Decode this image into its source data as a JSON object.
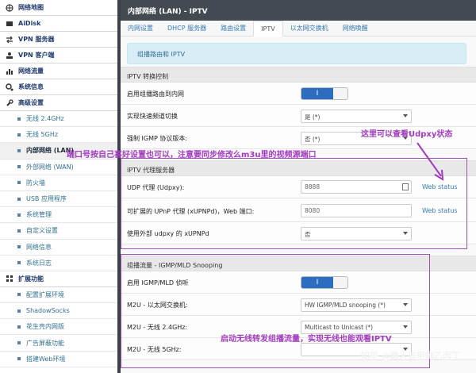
{
  "sidebar": {
    "top_items": [
      {
        "label": "网络地图",
        "icon": "globe-icon"
      },
      {
        "label": "AiDisk",
        "icon": "disk-icon"
      },
      {
        "label": "VPN 服务器",
        "icon": "swap-icon"
      },
      {
        "label": "VPN 客户端",
        "icon": "vpn-client-icon"
      },
      {
        "label": "网络流量",
        "icon": "chart-icon"
      },
      {
        "label": "系统信息",
        "icon": "gears-icon"
      },
      {
        "label": "高级设置",
        "icon": "wrench-icon"
      }
    ],
    "advanced_sub": [
      {
        "label": "无线 2.4GHz"
      },
      {
        "label": "无线 5GHz"
      },
      {
        "label": "内部网络 (LAN)",
        "current": true
      },
      {
        "label": "外部网络 (WAN)"
      },
      {
        "label": "防火墙"
      },
      {
        "label": "USB 应用程序"
      },
      {
        "label": "系统管理"
      },
      {
        "label": "自定义设置"
      },
      {
        "label": "网络信息"
      },
      {
        "label": "系统日志"
      }
    ],
    "ext_group": {
      "label": "扩展功能",
      "icon": "grid-icon"
    },
    "ext_sub": [
      {
        "label": "配置扩展环境"
      },
      {
        "label": "ShadowSocks"
      },
      {
        "label": "花生壳内网版"
      },
      {
        "label": "广告屏蔽功能"
      },
      {
        "label": "搭建Web环境"
      }
    ]
  },
  "header": {
    "title": "内部网络 (LAN) - IPTV"
  },
  "tabs": [
    {
      "label": "内网设置"
    },
    {
      "label": "DHCP 服务器"
    },
    {
      "label": "路由设置"
    },
    {
      "label": "IPTV",
      "active": true
    },
    {
      "label": "以太网交换机"
    },
    {
      "label": "网络唤醒"
    }
  ],
  "info": {
    "text": "组播路由和 IPTV"
  },
  "iptv_control": {
    "title": "IPTV 转换控制",
    "enable_multicast": {
      "label": "启用组播路由到内网",
      "state": "I"
    },
    "fast_switch": {
      "label": "实现快速频道切换",
      "value": "是 (*)"
    },
    "igmp_version": {
      "label": "强制 IGMP 协议版本:",
      "value": "否 (*)"
    }
  },
  "iptv_proxy": {
    "title": "IPTV 代理服务器",
    "udp_proxy": {
      "label": "UDP 代理 (Udpxy):",
      "value": "8888",
      "link": "Web status"
    },
    "upnp_proxy": {
      "label": "可扩展的 UPnP 代理 (xUPNPd)，Web 端口:",
      "value": "8080",
      "link": "Web status"
    },
    "ext_udpxy": {
      "label": "使用外部 udpxy 的 xUPNPd",
      "value": "否"
    }
  },
  "multicast": {
    "title": "组播流量 - IGMP/MLD Snooping",
    "igmp_snoop": {
      "label": "启用 IGMP/MLD 侦听",
      "state": "I"
    },
    "m2u_eth": {
      "label": "M2U - 以太网交换机:",
      "value": "HW IGMP/MLD snooping (*)"
    },
    "m2u_24": {
      "label": "M2U - 无线 2.4GHz:",
      "value": "Multicast to Unicast (*)"
    },
    "m2u_5": {
      "label": "M2U - 无线 5GHz:",
      "value": ""
    }
  },
  "annotations": {
    "udpxy_status": "这里可以查看Udpxy状态",
    "port_note": "端口号按自己喜好设置也可以，注意要同步修改么m3u里的视频源端口",
    "wifi_note": "启动无线转发组播流量，实现无线也能观看IPTV",
    "color": "#a23bbf"
  },
  "watermark": "知乎 @路人去甲剩乙丙丁"
}
